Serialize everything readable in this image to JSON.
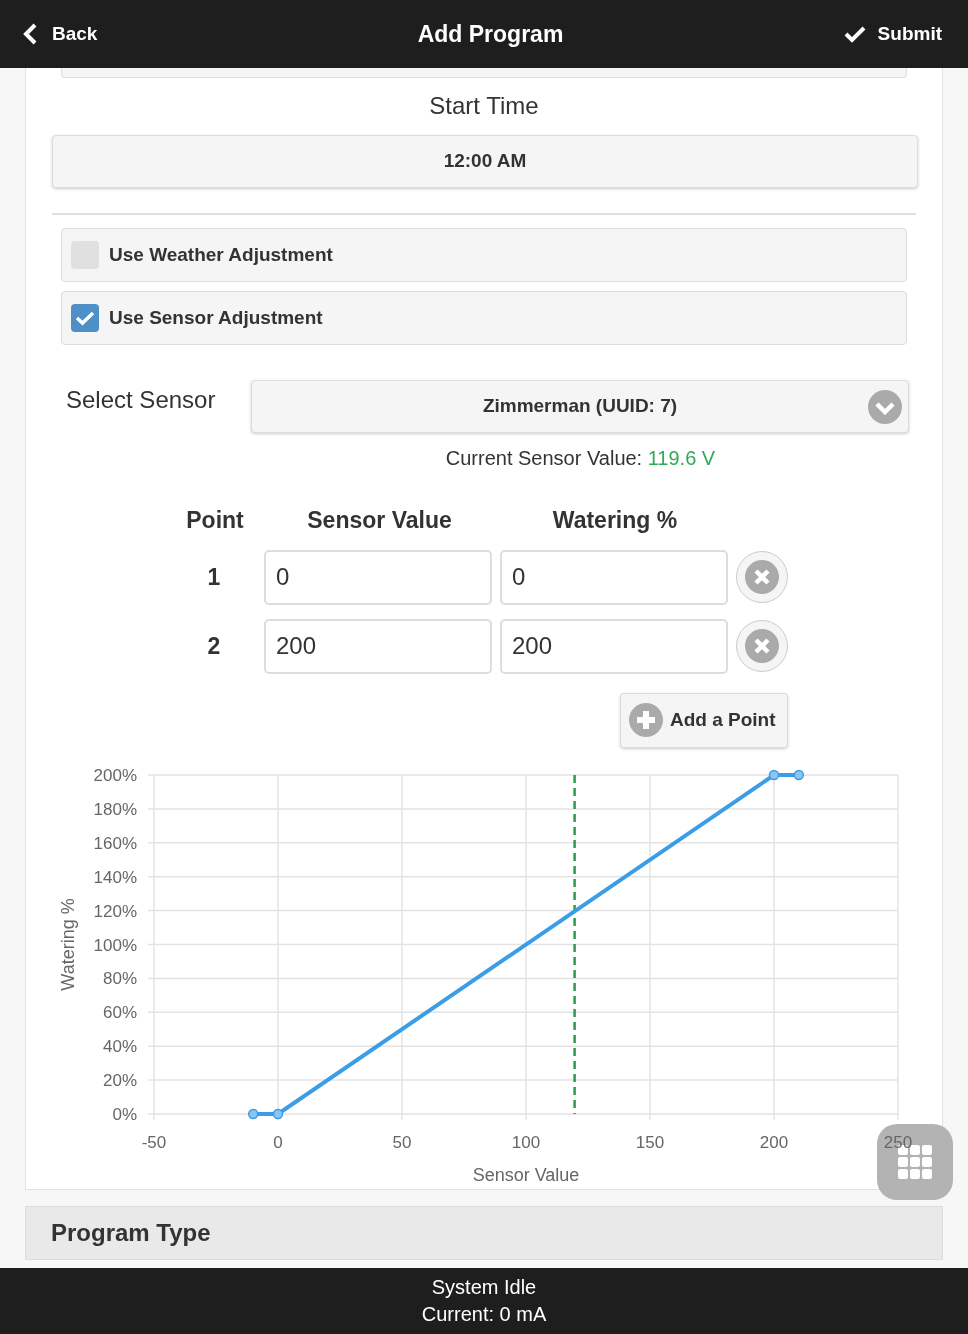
{
  "header": {
    "back": "Back",
    "title": "Add Program",
    "submit": "Submit"
  },
  "start_time": {
    "label": "Start Time",
    "value": "12:00 AM"
  },
  "options": [
    {
      "label": "Use Weather Adjustment",
      "checked": false
    },
    {
      "label": "Use Sensor Adjustment",
      "checked": true
    }
  ],
  "sensor": {
    "label": "Select Sensor",
    "value": "Zimmerman (UUID: 7)",
    "current_label": "Current Sensor Value:",
    "current_value": "119.6 V"
  },
  "points": {
    "columns": [
      "Point",
      "Sensor Value",
      "Watering %"
    ],
    "rows": [
      {
        "point": "1",
        "sensor_value": "0",
        "watering": "0"
      },
      {
        "point": "2",
        "sensor_value": "200",
        "watering": "200"
      }
    ],
    "add_button": "Add a Point"
  },
  "chart": {
    "chart_data": {
      "type": "line",
      "xlabel": "Sensor Value",
      "ylabel": "Watering %",
      "x": [
        -10,
        0,
        200,
        210
      ],
      "series": [
        {
          "color": "#3a9de6",
          "marker": "circle",
          "values": [
            0,
            0,
            200,
            200
          ]
        }
      ],
      "grid": true,
      "xlim": [
        -50,
        250
      ],
      "ylim": [
        0,
        200
      ],
      "xticks": [
        -50,
        0,
        50,
        100,
        150,
        200,
        250
      ],
      "yticks": [
        {
          "value": 0,
          "label": "0%"
        },
        {
          "value": 20,
          "label": "20%"
        },
        {
          "value": 40,
          "label": "40%"
        },
        {
          "value": 60,
          "label": "60%"
        },
        {
          "value": 80,
          "label": "80%"
        },
        {
          "value": 100,
          "label": "100%"
        },
        {
          "value": 120,
          "label": "120%"
        },
        {
          "value": 140,
          "label": "140%"
        },
        {
          "value": 160,
          "label": "160%"
        },
        {
          "value": 180,
          "label": "180%"
        },
        {
          "value": 200,
          "label": "200%"
        }
      ],
      "ref_lines": [
        {
          "axis": "x",
          "value": 119.6,
          "color": "#2a9d4a"
        }
      ]
    }
  },
  "section": {
    "title": "Program Type"
  },
  "status_bar": {
    "state": "System Idle",
    "current": "Current: 0 mA"
  }
}
